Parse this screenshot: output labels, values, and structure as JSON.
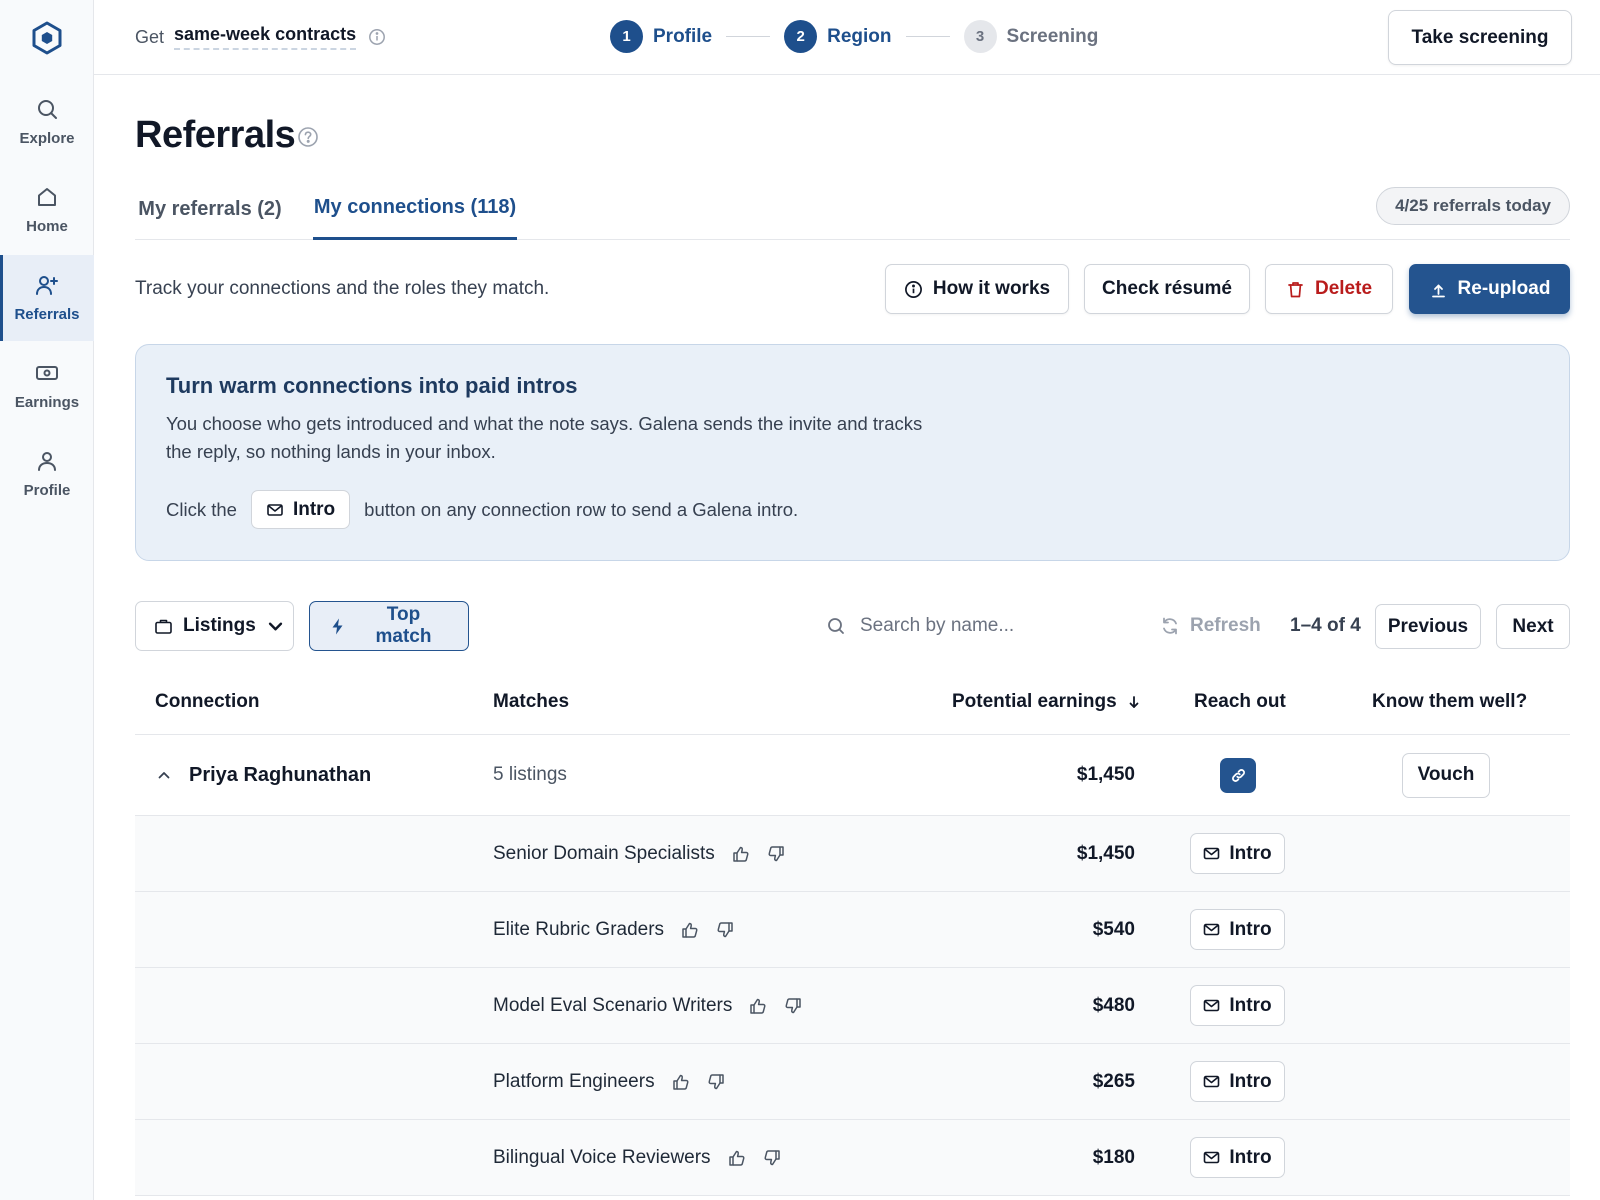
{
  "nav": {
    "logo_icon": "hexagon-logo",
    "items": [
      {
        "label": "Explore",
        "icon": "search-icon"
      },
      {
        "label": "Home",
        "icon": "home-icon"
      },
      {
        "label": "Referrals",
        "icon": "user-plus-icon",
        "active": true
      },
      {
        "label": "Earnings",
        "icon": "banknote-icon"
      },
      {
        "label": "Profile",
        "icon": "user-icon"
      }
    ]
  },
  "topbar": {
    "get_prefix": "Get",
    "get_highlight": "same-week contracts",
    "steps": [
      {
        "number": "1",
        "label": "Profile",
        "status": "complete"
      },
      {
        "number": "2",
        "label": "Region",
        "status": "complete"
      },
      {
        "number": "3",
        "label": "Screening",
        "status": "upcoming"
      }
    ],
    "cta": "Take screening"
  },
  "page": {
    "title": "Referrals",
    "tabs": [
      {
        "label": "My referrals (2)",
        "active": false
      },
      {
        "label": "My connections (118)",
        "active": true
      }
    ],
    "quota": "4/25 referrals today",
    "subtitle": "Track your connections and the roles they match.",
    "actions": {
      "how": "How it works",
      "check": "Check résumé",
      "delete": "Delete",
      "upload": "Re-upload"
    }
  },
  "banner": {
    "title": "Turn warm connections into paid intros",
    "body": "You choose who gets introduced and what the note says. Galena sends the invite and tracks the reply, so nothing lands in your inbox.",
    "click_prefix": "Click the",
    "click_button": "Intro",
    "click_suffix": "button on any connection row to send a Galena intro."
  },
  "toolbar": {
    "listings_filter": "Listings",
    "top_match": "Top match",
    "search_placeholder": "Search by name...",
    "refresh": "Refresh",
    "range": "1–4 of 4",
    "previous": "Previous",
    "next": "Next"
  },
  "table": {
    "columns": {
      "connection": "Connection",
      "matches": "Matches",
      "earnings": "Potential earnings",
      "reach_out": "Reach out",
      "know_well": "Know them well?"
    },
    "sort": {
      "column": "earnings",
      "direction": "descending"
    },
    "connection": {
      "name": "Priya Raghunathan",
      "matches": "5 listings",
      "earnings": "$1,450",
      "vouch": "Vouch",
      "expanded": true
    },
    "listings": [
      {
        "title": "Senior Domain Specialists",
        "earnings": "$1,450",
        "action": "Intro"
      },
      {
        "title": "Elite Rubric Graders",
        "earnings": "$540",
        "action": "Intro"
      },
      {
        "title": "Model Eval Scenario Writers",
        "earnings": "$480",
        "action": "Intro"
      },
      {
        "title": "Platform Engineers",
        "earnings": "$265",
        "action": "Intro"
      },
      {
        "title": "Bilingual Voice Reviewers",
        "earnings": "$180",
        "action": "Intro"
      }
    ]
  },
  "colors": {
    "primary": "#24548f",
    "primary_dark": "#1e4f8c",
    "danger": "#b91c1c",
    "banner_bg": "#e9f0f8",
    "sidebar_bg": "#f8fafc"
  }
}
